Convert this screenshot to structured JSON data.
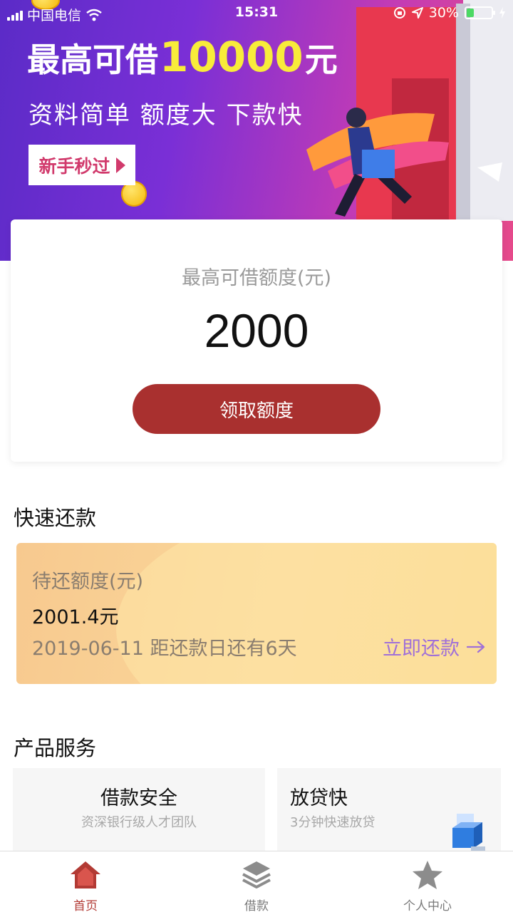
{
  "status_bar": {
    "carrier": "中国电信",
    "time": "15:31",
    "battery": "30%"
  },
  "banner": {
    "title_prefix": "最高可借",
    "title_amount": "10000",
    "title_suffix": "元",
    "subtitle": "资料简单 额度大 下款快",
    "button_label": "新手秒过"
  },
  "quota": {
    "label": "最高可借额度(元)",
    "value": "2000",
    "button_label": "领取额度"
  },
  "repay": {
    "section_title": "快速还款",
    "label": "待还额度(元)",
    "amount": "2001.4元",
    "due_text": "2019-06-11  距还款日还有6天",
    "action_label": "立即还款"
  },
  "products": {
    "section_title": "产品服务",
    "items": [
      {
        "title": "借款安全",
        "desc": "资深银行级人才团队"
      },
      {
        "title": "放贷快",
        "desc": "3分钟快速放贷"
      }
    ]
  },
  "tabs": [
    {
      "label": "首页",
      "icon": "home-icon",
      "active": true
    },
    {
      "label": "借款",
      "icon": "layers-icon",
      "active": false
    },
    {
      "label": "个人中心",
      "icon": "star-icon",
      "active": false
    }
  ],
  "colors": {
    "accent_red": "#a9302f",
    "tab_active": "#b23a34",
    "banner_highlight": "#f8ec3a",
    "link_purple": "#a070d8",
    "repay_card": "#f9cf90"
  }
}
